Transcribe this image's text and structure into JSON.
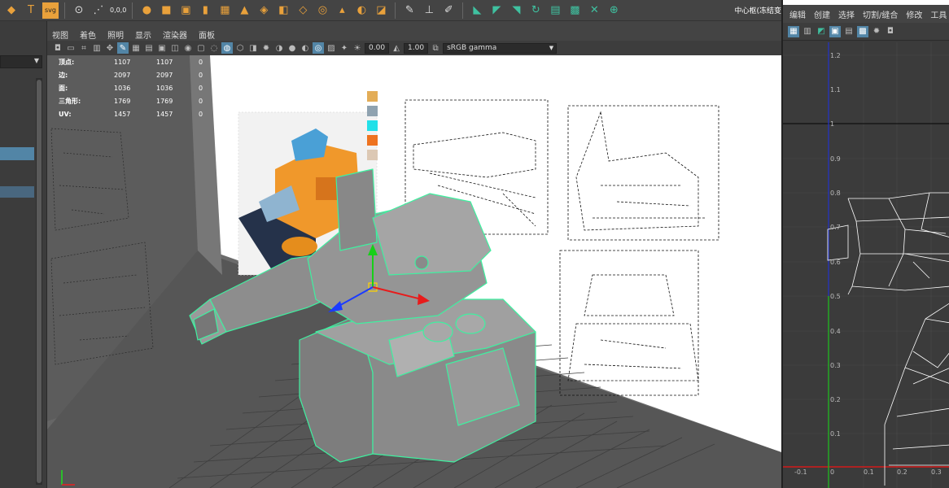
{
  "shelf": {
    "icons": [
      "move-arrow-icon",
      "text-icon",
      "svg-icon",
      "inspect-icon",
      "measure-icon",
      "sphere-icon",
      "cube-icon",
      "box-icon",
      "cylinder-icon",
      "grid-icon",
      "pyramid-icon",
      "helix-icon",
      "pipe-icon",
      "plane-icon",
      "torus-icon",
      "cone-icon",
      "disk-icon",
      "edit-icon",
      "extrude-icon",
      "bevel-icon",
      "fill-icon",
      "split-icon",
      "merge-icon",
      "cut-icon",
      "knife-icon"
    ],
    "svg_label": "svg",
    "coords_label": "0,0,0",
    "right_label": "中心枢(冻结变"
  },
  "viewport": {
    "menus": [
      "视图",
      "着色",
      "照明",
      "显示",
      "渲染器",
      "面板"
    ],
    "exposure_value": "0.00",
    "gamma_value": "1.00",
    "color_space": "sRGB gamma"
  },
  "hud": {
    "rows": [
      {
        "label": "顶点:",
        "a": "1107",
        "b": "1107",
        "c": "0"
      },
      {
        "label": "边:",
        "a": "2097",
        "b": "2097",
        "c": "0"
      },
      {
        "label": "面:",
        "a": "1036",
        "b": "1036",
        "c": "0"
      },
      {
        "label": "三角形:",
        "a": "1769",
        "b": "1769",
        "c": "0"
      },
      {
        "label": "UV:",
        "a": "1457",
        "b": "1457",
        "c": "0"
      }
    ]
  },
  "palette": [
    "#e3ad57",
    "#8fa2b0",
    "#22e0e8",
    "#ee7320",
    "#dcc8b4"
  ],
  "uv_editor": {
    "menus": [
      "编辑",
      "创建",
      "选择",
      "切割/缝合",
      "修改",
      "工具"
    ],
    "y_ticks": [
      "1.2",
      "1.1",
      "1",
      "0.9",
      "0.8",
      "0.7",
      "0.6",
      "0.5",
      "0.4",
      "0.3",
      "0.2",
      "0.1"
    ],
    "x_ticks": [
      "-0.1",
      "0",
      "0.1",
      "0.2",
      "0.3"
    ]
  }
}
